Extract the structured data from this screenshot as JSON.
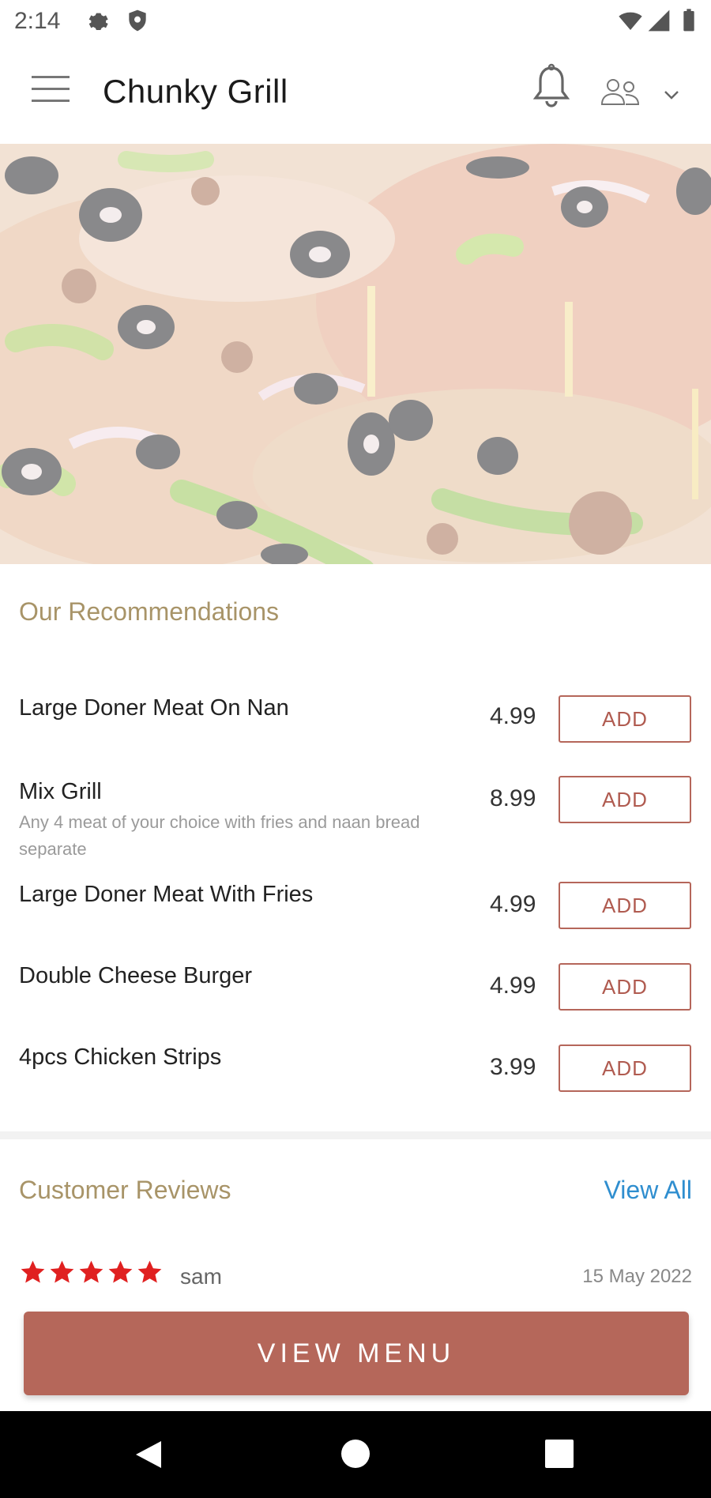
{
  "status_bar": {
    "time": "2:14"
  },
  "app_bar": {
    "title": "Chunky Grill"
  },
  "recommendations": {
    "title": "Our Recommendations",
    "items": [
      {
        "name": "Large Doner Meat On Nan",
        "description": "",
        "price": "4.99",
        "button": "ADD"
      },
      {
        "name": "Mix Grill",
        "description": "Any 4 meat of your choice with fries and naan bread separate",
        "price": "8.99",
        "button": "ADD"
      },
      {
        "name": "Large Doner Meat With Fries",
        "description": "",
        "price": "4.99",
        "button": "ADD"
      },
      {
        "name": "Double Cheese Burger",
        "description": "",
        "price": "4.99",
        "button": "ADD"
      },
      {
        "name": "4pcs Chicken Strips",
        "description": "",
        "price": "3.99",
        "button": "ADD"
      }
    ]
  },
  "reviews": {
    "title": "Customer Reviews",
    "view_all": "View All",
    "first": {
      "rating": 5,
      "reviewer": "sam",
      "date": "15 May 2022"
    }
  },
  "cta": {
    "view_menu": "VIEW MENU"
  },
  "colors": {
    "accent": "#b5675a",
    "section_title": "#a89468",
    "link": "#2f8ecf",
    "star": "#e02020"
  }
}
